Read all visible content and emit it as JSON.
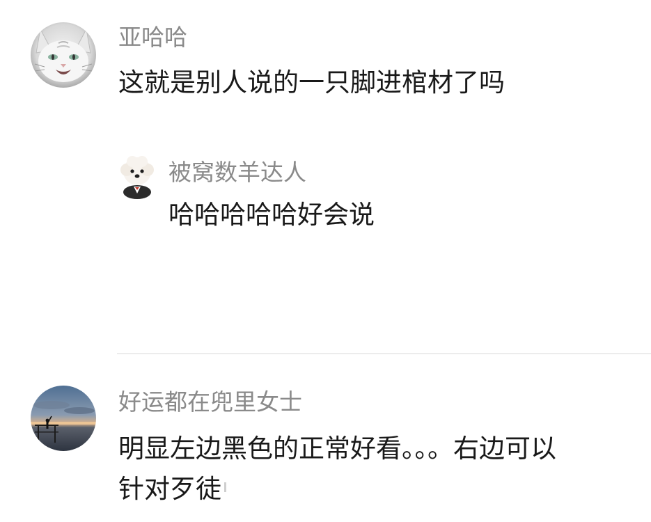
{
  "colors": {
    "username": "#8a8a8a",
    "content": "#191919",
    "divider": "#ececec",
    "background": "#ffffff"
  },
  "comments": [
    {
      "username": "亚哈哈",
      "content": "这就是别人说的一只脚进棺材了吗",
      "avatar_icon": "white-cat-avatar",
      "replies": [
        {
          "username": "被窝数羊达人",
          "content": "哈哈哈哈哈好会说",
          "avatar_icon": "white-dog-in-suit-avatar"
        }
      ]
    },
    {
      "username": "好运都在兜里女士",
      "content_line1": "明显左边黑色的正常好看。。。右边可以",
      "content_line2": "针对歹徒",
      "avatar_icon": "sunset-pier-avatar"
    }
  ]
}
